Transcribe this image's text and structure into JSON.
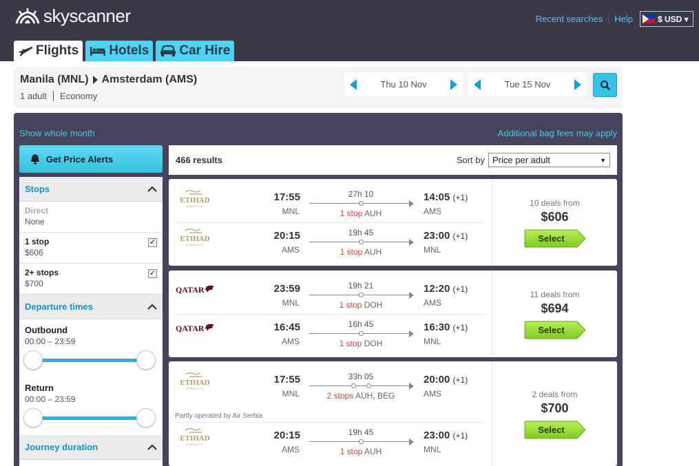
{
  "brand": {
    "name": "skyscanner"
  },
  "top_links": {
    "recent": "Recent searches",
    "help": "Help",
    "currency": "$ USD ▾"
  },
  "tabs": [
    {
      "label": "Flights",
      "icon": "plane-icon"
    },
    {
      "label": "Hotels",
      "icon": "bed-icon"
    },
    {
      "label": "Car Hire",
      "icon": "car-icon"
    }
  ],
  "search": {
    "origin": "Manila (MNL)",
    "destination": "Amsterdam (AMS)",
    "passengers": "1 adult",
    "cabin": "Economy",
    "depart_date": "Thu 10 Nov",
    "return_date": "Tue 15 Nov"
  },
  "panel": {
    "show_month": "Show whole month",
    "bag_fees": "Additional bag fees may apply",
    "price_alerts": "Get Price Alerts",
    "results_count": "466 results",
    "sort_label": "Sort by",
    "sort_value": "Price per adult"
  },
  "filters": {
    "stops_title": "Stops",
    "options": [
      {
        "label": "Direct",
        "sub": "None",
        "enabled": false,
        "checked": false
      },
      {
        "label": "1 stop",
        "sub": "$606",
        "enabled": true,
        "checked": true
      },
      {
        "label": "2+ stops",
        "sub": "$700",
        "enabled": true,
        "checked": true
      }
    ],
    "departure_title": "Departure times",
    "outbound": {
      "label": "Outbound",
      "range": "00:00 – 23:59"
    },
    "return": {
      "label": "Return",
      "range": "00:00 – 23:59"
    },
    "journey_title": "Journey duration"
  },
  "results": [
    {
      "deals": "10 deals from",
      "price": "$606",
      "select": "Select",
      "legs": [
        {
          "airline": "ETIHAD",
          "airline_sub": "AIRWAYS",
          "dep": "17:55",
          "dep_ap": "MNL",
          "dur": "27h 10",
          "stops_count": "1 stop",
          "stops_via": "AUH",
          "arr": "14:05",
          "plus": "(+1)",
          "arr_ap": "AMS"
        },
        {
          "airline": "ETIHAD",
          "airline_sub": "AIRWAYS",
          "dep": "20:15",
          "dep_ap": "AMS",
          "dur": "19h 45",
          "stops_count": "1 stop",
          "stops_via": "AUH",
          "arr": "23:00",
          "plus": "(+1)",
          "arr_ap": "MNL"
        }
      ]
    },
    {
      "deals": "11 deals from",
      "price": "$694",
      "select": "Select",
      "legs": [
        {
          "airline": "QATAR",
          "airline_sub": "",
          "dep": "23:59",
          "dep_ap": "MNL",
          "dur": "19h 21",
          "stops_count": "1 stop",
          "stops_via": "DOH",
          "arr": "12:20",
          "plus": "(+1)",
          "arr_ap": "AMS"
        },
        {
          "airline": "QATAR",
          "airline_sub": "",
          "dep": "16:45",
          "dep_ap": "AMS",
          "dur": "16h 45",
          "stops_count": "1 stop",
          "stops_via": "DOH",
          "arr": "16:30",
          "plus": "(+1)",
          "arr_ap": "MNL"
        }
      ]
    },
    {
      "deals": "2 deals from",
      "price": "$700",
      "select": "Select",
      "partly": "Partly operated by Air Serbia",
      "legs": [
        {
          "airline": "ETIHAD",
          "airline_sub": "AIRWAYS",
          "dep": "17:55",
          "dep_ap": "MNL",
          "dur": "33h 05",
          "stops_count": "2 stops",
          "stops_via": "AUH, BEG",
          "arr": "20:00",
          "plus": "(+1)",
          "arr_ap": "AMS"
        },
        {
          "airline": "ETIHAD",
          "airline_sub": "AIRWAYS",
          "dep": "20:15",
          "dep_ap": "AMS",
          "dur": "19h 45",
          "stops_count": "1 stop",
          "stops_via": "AUH",
          "arr": "23:00",
          "plus": "(+1)",
          "arr_ap": "MNL"
        }
      ]
    }
  ],
  "colors": {
    "header": "#3b3849",
    "accent": "#4fc4e8",
    "select_green": "#8fd62c",
    "stop_red": "#d9453c"
  }
}
